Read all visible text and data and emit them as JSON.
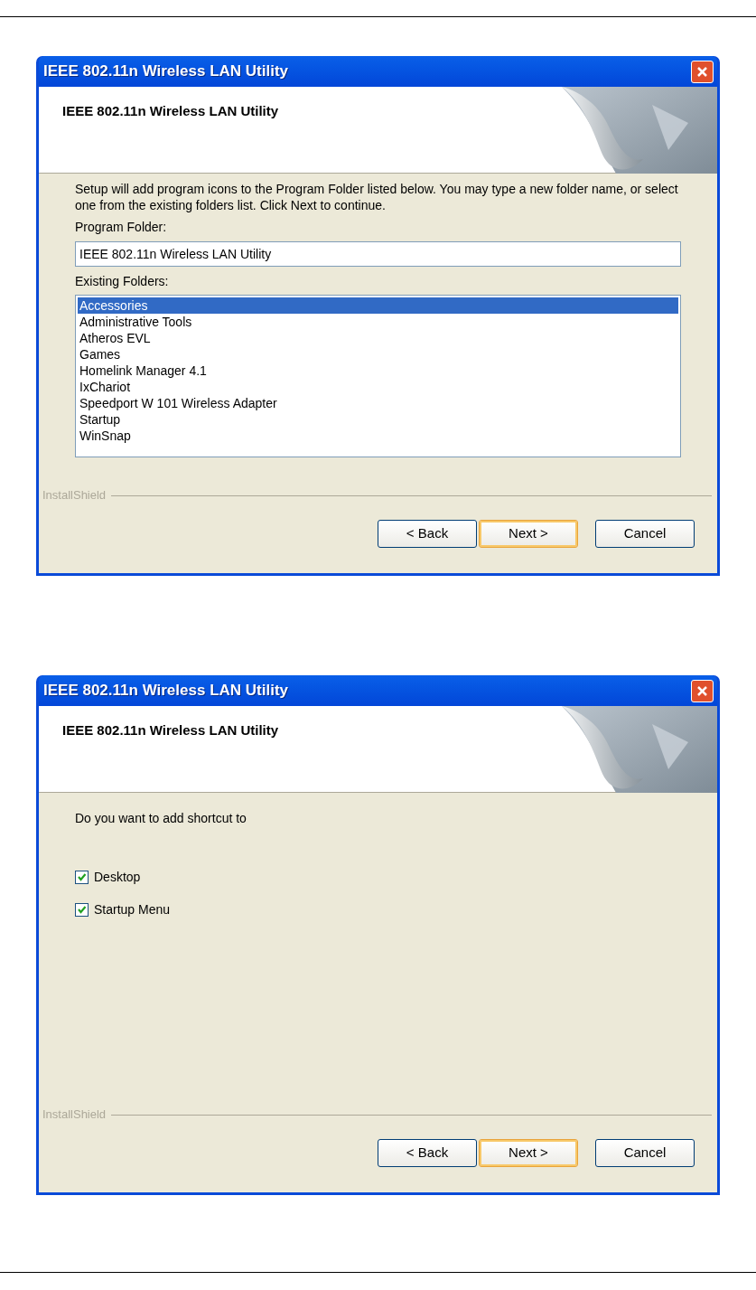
{
  "dialogs": [
    {
      "kind": "folder",
      "title": "IEEE 802.11n Wireless LAN Utility",
      "heading": "IEEE 802.11n Wireless LAN Utility",
      "intro": "Setup will add program icons to the Program Folder listed below.  You may type a new folder name, or select one from the existing folders list.  Click Next to continue.",
      "folder_label": "Program Folder:",
      "folder_value": "IEEE 802.11n Wireless LAN Utility",
      "list_label": "Existing Folders:",
      "folders": [
        {
          "label": "Accessories",
          "selected": true
        },
        {
          "label": "Administrative Tools",
          "selected": false
        },
        {
          "label": "Atheros EVL",
          "selected": false
        },
        {
          "label": "Games",
          "selected": false
        },
        {
          "label": "Homelink Manager 4.1",
          "selected": false
        },
        {
          "label": "IxChariot",
          "selected": false
        },
        {
          "label": "Speedport W 101 Wireless Adapter",
          "selected": false
        },
        {
          "label": "Startup",
          "selected": false
        },
        {
          "label": "WinSnap",
          "selected": false
        }
      ],
      "brand": "InstallShield",
      "buttons": [
        {
          "label": "< Back",
          "default": false
        },
        {
          "label": "Next >",
          "default": true
        },
        {
          "label": "Cancel",
          "default": false
        }
      ]
    },
    {
      "kind": "shortcuts",
      "title": "IEEE 802.11n Wireless LAN Utility",
      "heading": "IEEE 802.11n Wireless LAN Utility",
      "intro": "Do you want to add shortcut to",
      "options": [
        {
          "label": "Desktop",
          "checked": true
        },
        {
          "label": "Startup Menu",
          "checked": true
        }
      ],
      "brand": "InstallShield",
      "buttons": [
        {
          "label": "< Back",
          "default": false
        },
        {
          "label": "Next >",
          "default": true
        },
        {
          "label": "Cancel",
          "default": false
        }
      ]
    }
  ]
}
